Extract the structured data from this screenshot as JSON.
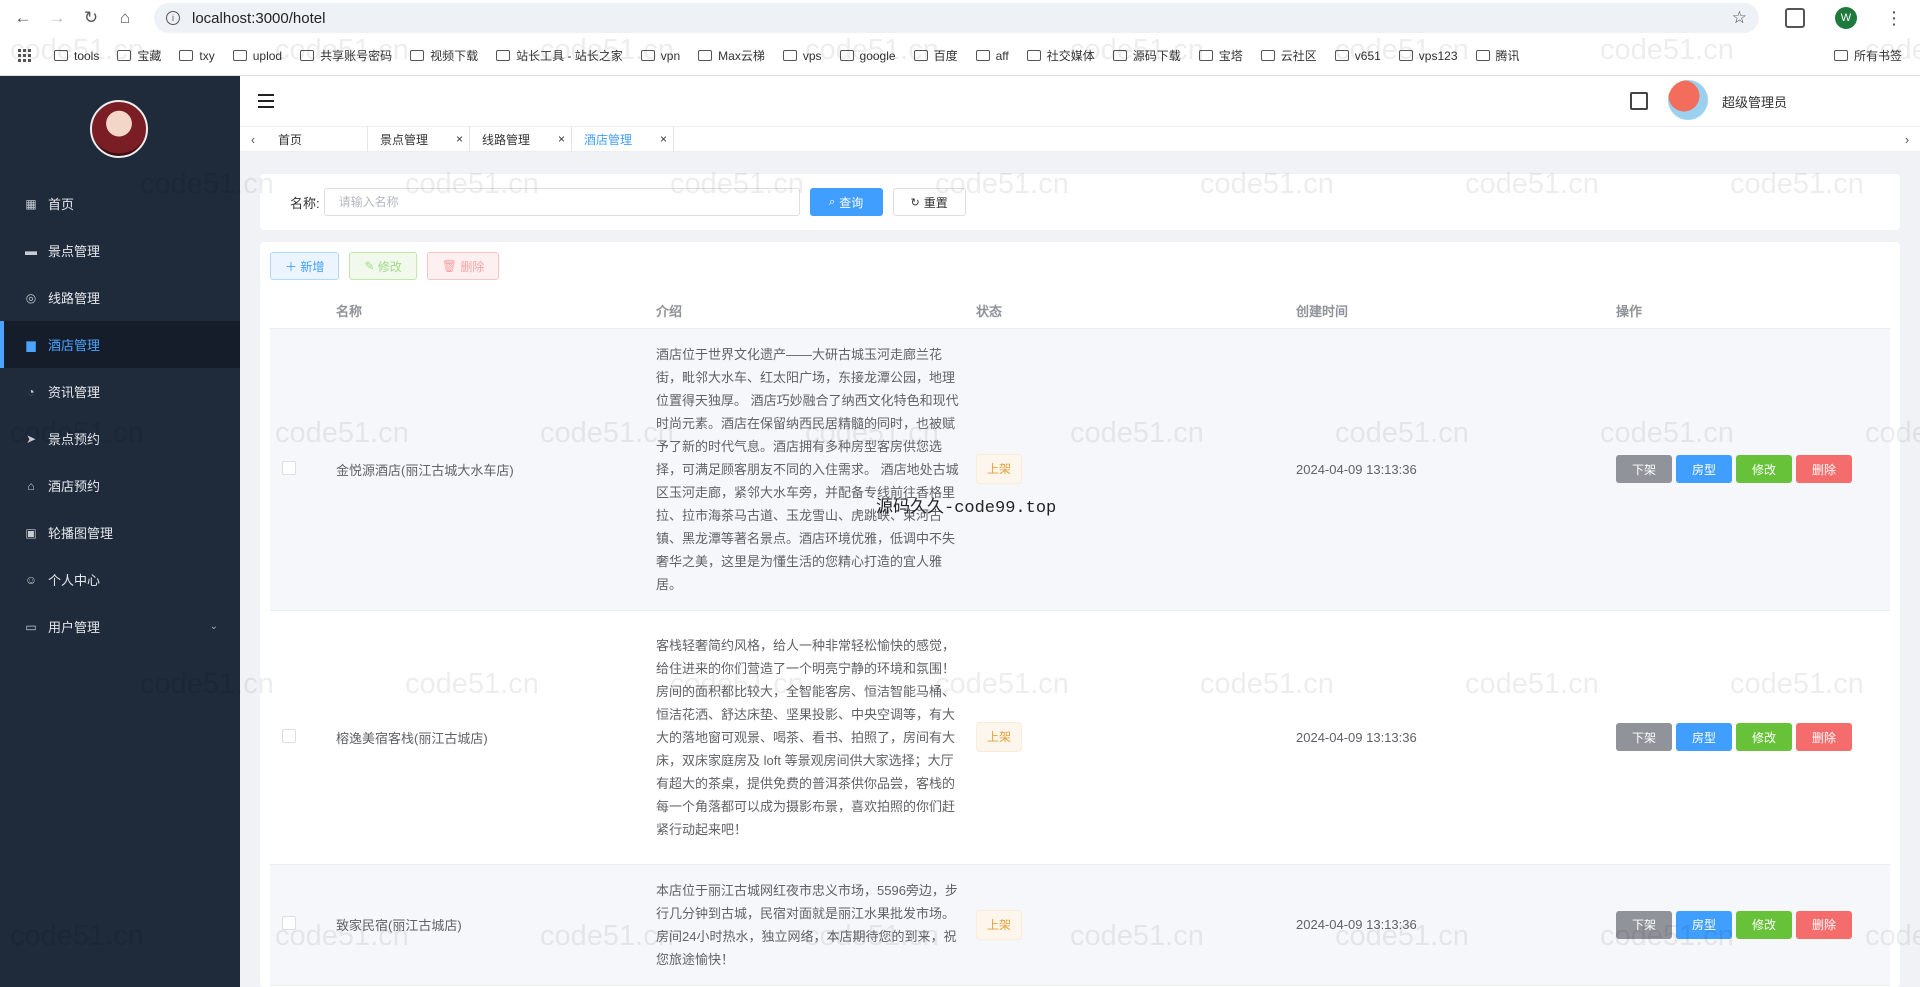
{
  "browser": {
    "url": "localhost:3000/hotel",
    "profile_initial": "W"
  },
  "bookmarks": [
    "tools",
    "宝藏",
    "txy",
    "uplod",
    "共享账号密码",
    "视频下载",
    "站长工具 - 站长之家",
    "vpn",
    "Max云梯",
    "vps",
    "google",
    "百度",
    "aff",
    "社交媒体",
    "源码下载",
    "宝塔",
    "云社区",
    "v651",
    "vps123",
    "腾讯"
  ],
  "bookmarks_all": "所有书签",
  "sidebar": {
    "items": [
      {
        "label": "首页",
        "icon": "dashboard-icon"
      },
      {
        "label": "景点管理",
        "icon": "ticket-icon"
      },
      {
        "label": "线路管理",
        "icon": "route-icon"
      },
      {
        "label": "酒店管理",
        "icon": "hotel-icon",
        "active": true
      },
      {
        "label": "资讯管理",
        "icon": "compass-icon"
      },
      {
        "label": "景点预约",
        "icon": "send-icon"
      },
      {
        "label": "酒店预约",
        "icon": "home-icon"
      },
      {
        "label": "轮播图管理",
        "icon": "image-icon"
      },
      {
        "label": "个人中心",
        "icon": "user-icon"
      },
      {
        "label": "用户管理",
        "icon": "monitor-icon",
        "has_children": true
      }
    ]
  },
  "header": {
    "user_name": "超级管理员"
  },
  "tabs": [
    {
      "label": "首页",
      "closable": false
    },
    {
      "label": "景点管理",
      "closable": true
    },
    {
      "label": "线路管理",
      "closable": true
    },
    {
      "label": "酒店管理",
      "closable": true,
      "active": true
    }
  ],
  "search": {
    "label": "名称:",
    "placeholder": "请输入名称",
    "query_label": "查询",
    "reset_label": "重置"
  },
  "toolbar": {
    "add_label": "新增",
    "edit_label": "修改",
    "delete_label": "删除"
  },
  "table": {
    "columns": [
      "名称",
      "介绍",
      "状态",
      "创建时间",
      "操作"
    ],
    "rows": [
      {
        "name": "金悦源酒店(丽江古城大水车店)",
        "desc": "酒店位于世界文化遗产——大研古城玉河走廊兰花街，毗邻大水车、红太阳广场，东接龙潭公园，地理位置得天独厚。 酒店巧妙融合了纳西文化特色和现代时尚元素。酒店在保留纳西民居精髓的同时，也被赋予了新的时代气息。酒店拥有多种房型客房供您选择，可满足顾客朋友不同的入住需求。 酒店地处古城区玉河走廊，紧邻大水车旁，并配备专线前往香格里拉、拉市海茶马古道、玉龙雪山、虎跳峡、束河古镇、黑龙潭等著名景点。酒店环境优雅，低调中不失奢华之美，这里是为懂生活的您精心打造的宜人雅居。",
        "status": "上架",
        "created": "2024-04-09 13:13:36"
      },
      {
        "name": "榕逸美宿客栈(丽江古城店)",
        "desc": "客栈轻奢简约风格，给人一种非常轻松愉快的感觉，给住进来的你们营造了一个明亮宁静的环境和氛围！房间的面积都比较大，全智能客房、恒洁智能马桶、恒洁花洒、舒达床垫、坚果投影、中央空调等，有大大的落地窗可观景、喝茶、看书、拍照了，房间有大床，双床家庭房及 loft 等景观房间供大家选择；大厅有超大的茶桌，提供免费的普洱茶供你品尝，客栈的每一个角落都可以成为摄影布景，喜欢拍照的你们赶紧行动起来吧！",
        "status": "上架",
        "created": "2024-04-09 13:13:36"
      },
      {
        "name": "致家民宿(丽江古城店)",
        "desc": "本店位于丽江古城网红夜市忠义市场，5596旁边，步行几分钟到古城，民宿对面就是丽江水果批发市场。房间24小时热水，独立网络，本店期待您的到来，祝您旅途愉快！",
        "status": "上架",
        "created": "2024-04-09 13:13:36"
      }
    ],
    "actions": {
      "off": "下架",
      "room": "房型",
      "edit": "修改",
      "delete": "删除"
    }
  },
  "watermarks": {
    "repeat_text": "code51.cn",
    "center_text": "源码久久-code99.top"
  }
}
